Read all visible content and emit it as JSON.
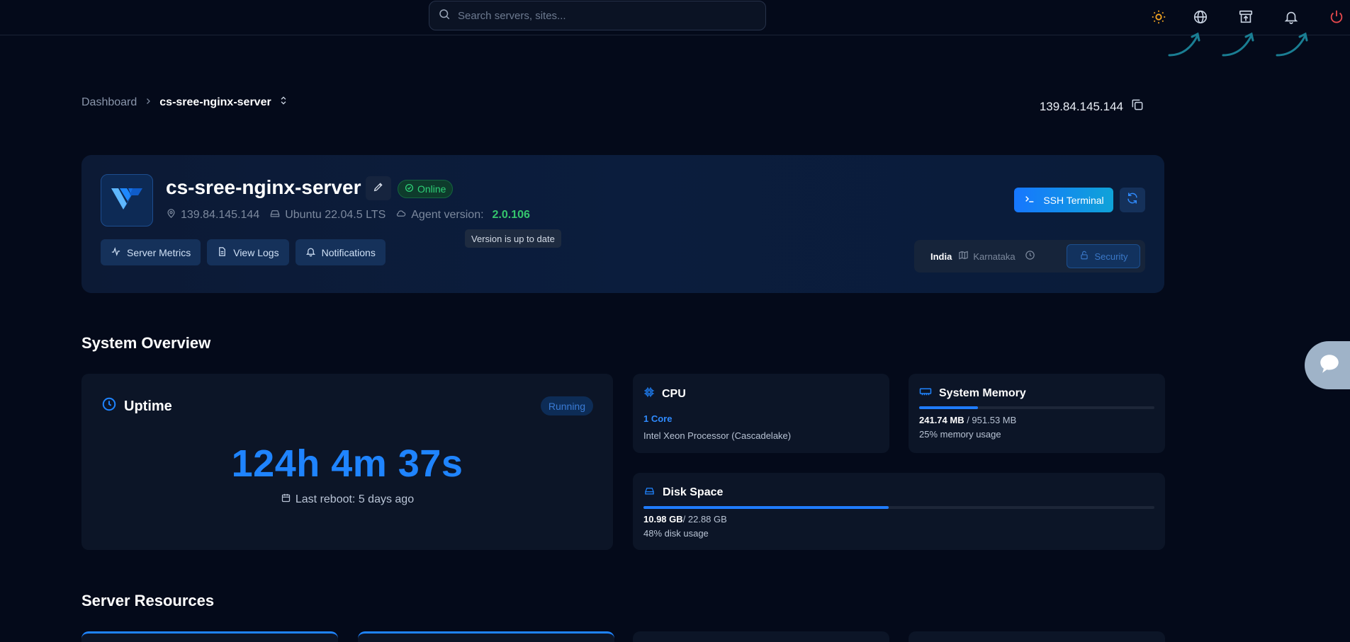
{
  "search": {
    "placeholder": "Search servers, sites..."
  },
  "topbar": {
    "icons": [
      "sun-icon",
      "globe-icon",
      "archive-upload-icon",
      "bell-icon",
      "power-icon"
    ]
  },
  "breadcrumb": {
    "home": "Dashboard",
    "current": "cs-sree-nginx-server"
  },
  "header_ip": "139.84.145.144",
  "server": {
    "name": "cs-sree-nginx-server",
    "status": "Online",
    "ip": "139.84.145.144",
    "os": "Ubuntu 22.04.5 LTS",
    "agent_label": "Agent version:",
    "agent_version": "2.0.106",
    "tooltip": "Version is up to date",
    "actions": {
      "metrics": "Server Metrics",
      "logs": "View Logs",
      "notifications": "Notifications"
    },
    "ssh_label": "SSH Terminal",
    "location": {
      "country": "India",
      "region": "Karnataka"
    },
    "security_label": "Security"
  },
  "overview": {
    "title": "System Overview",
    "uptime": {
      "label": "Uptime",
      "badge": "Running",
      "value": "124h 4m 37s",
      "last_reboot": "Last reboot: 5 days ago"
    },
    "cpu": {
      "label": "CPU",
      "cores": "1 Core",
      "model": "Intel Xeon Processor (Cascadelake)"
    },
    "memory": {
      "label": "System Memory",
      "used": "241.74 MB",
      "total": " / 951.53 MB",
      "usage": "25% memory usage",
      "percent": 25
    },
    "disk": {
      "label": "Disk Space",
      "used": "10.98 GB",
      "total": "/ 22.88 GB",
      "usage": "48% disk usage",
      "percent": 48
    }
  },
  "resources": {
    "title": "Server Resources"
  },
  "colors": {
    "accent": "#1f84ff",
    "online": "#2ecf77",
    "power": "#e5484d",
    "sun": "#f5a623"
  }
}
